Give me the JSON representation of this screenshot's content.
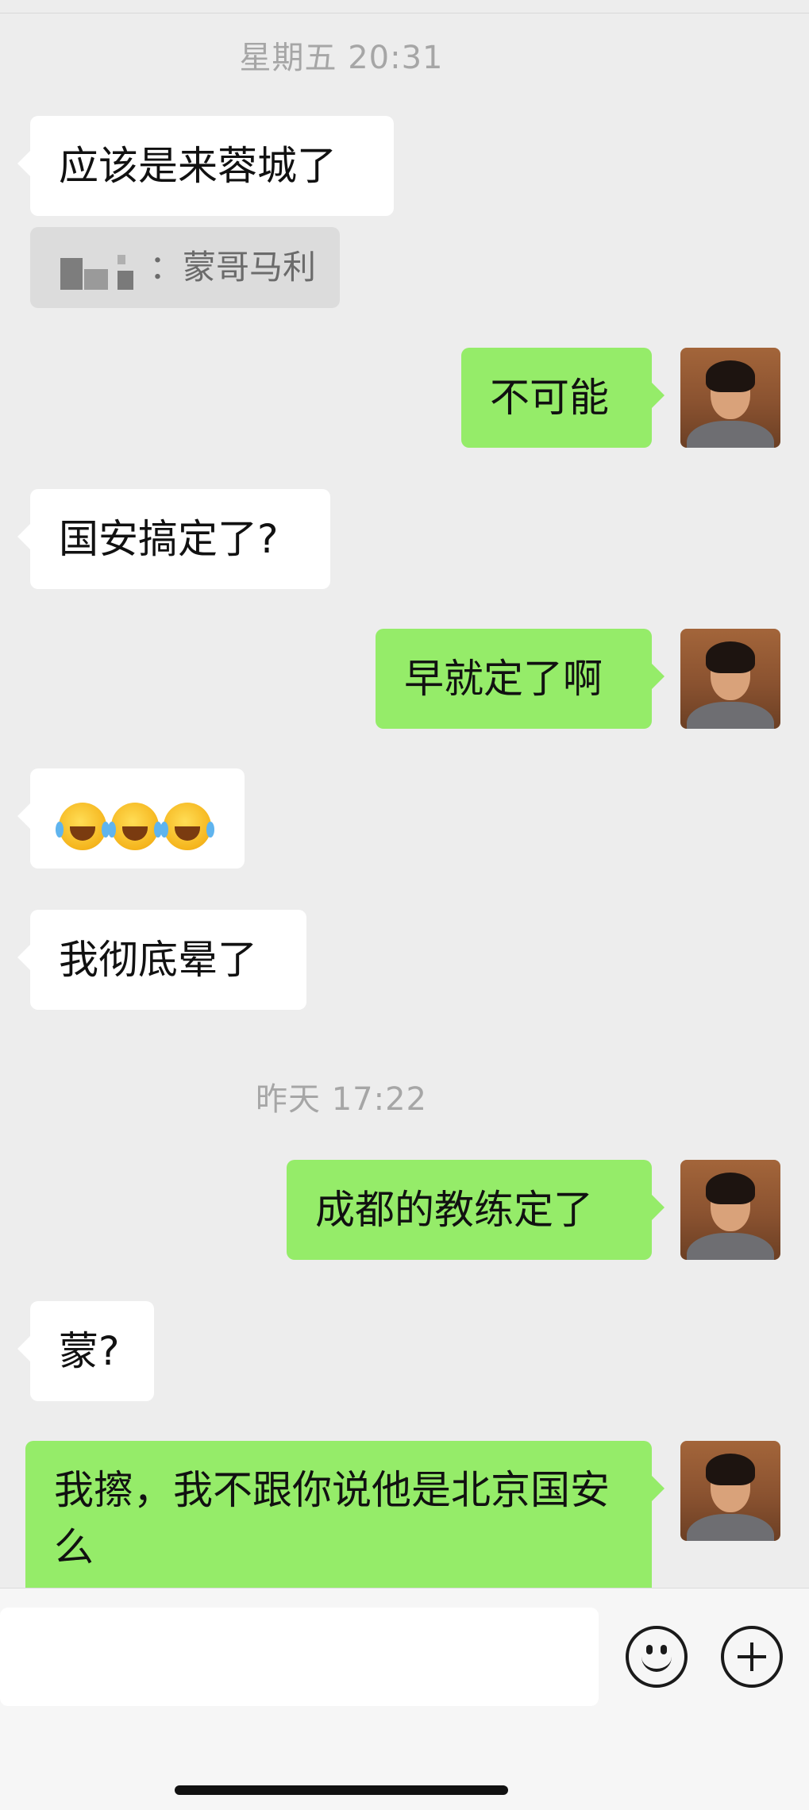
{
  "timestamps": [
    "星期五 20:31",
    "昨天 17:22"
  ],
  "messages": [
    {
      "side": "in",
      "text": "应该是来蓉城了"
    },
    {
      "side": "out",
      "text": "不可能"
    },
    {
      "side": "in",
      "text": "国安搞定了?"
    },
    {
      "side": "out",
      "text": "早就定了啊"
    },
    {
      "side": "in",
      "emoji": [
        "joy-tears-emoji",
        "joy-tears-emoji",
        "joy-tears-emoji"
      ]
    },
    {
      "side": "in",
      "text": "我彻底晕了"
    },
    {
      "side": "out",
      "text": "成都的教练定了"
    },
    {
      "side": "in",
      "text": "蒙?"
    },
    {
      "side": "out",
      "text": "我擦，我不跟你说他是北京国安么"
    }
  ],
  "quote": {
    "sender_sep": "：",
    "text": "蒙哥马利"
  },
  "input_bar": {
    "icons": [
      "emoji-smile-icon",
      "plus-icon"
    ]
  },
  "colors": {
    "background": "#ededed",
    "incoming": "#ffffff",
    "outgoing": "#95ec69"
  }
}
